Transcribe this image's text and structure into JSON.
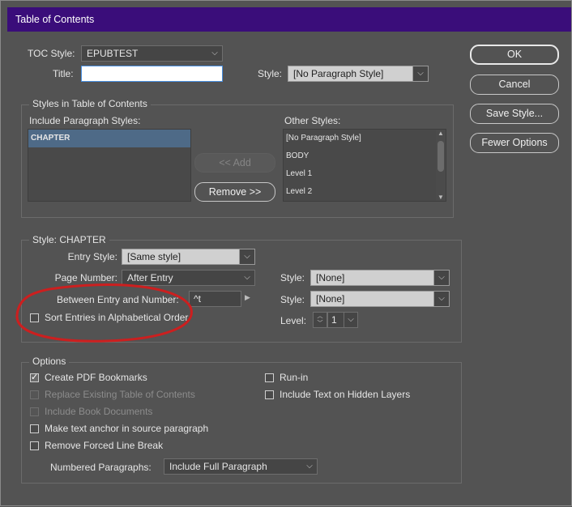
{
  "window": {
    "title": "Table of Contents"
  },
  "top": {
    "toc_style_label": "TOC Style:",
    "toc_style_value": "EPUBTEST",
    "title_label": "Title:",
    "title_value": "",
    "style_label": "Style:",
    "style_value": "[No Paragraph Style]"
  },
  "buttons": {
    "ok": "OK",
    "cancel": "Cancel",
    "save_style": "Save Style...",
    "fewer_options": "Fewer Options",
    "add": "<< Add",
    "remove": "Remove >>"
  },
  "styles_in_toc": {
    "group_title": "Styles in Table of Contents",
    "include_label": "Include Paragraph Styles:",
    "include_items": [
      "CHAPTER"
    ],
    "other_label": "Other Styles:",
    "other_items": [
      "[No Paragraph Style]",
      "BODY",
      "Level 1",
      "Level 2"
    ]
  },
  "style_section": {
    "group_title": "Style: CHAPTER",
    "entry_style_label": "Entry Style:",
    "entry_style_value": "[Same style]",
    "page_number_label": "Page Number:",
    "page_number_value": "After Entry",
    "between_label": "Between Entry and Number:",
    "between_value": "^t",
    "style1_label": "Style:",
    "style1_value": "[None]",
    "style2_label": "Style:",
    "style2_value": "[None]",
    "sort_label": "Sort Entries in Alphabetical Order",
    "level_label": "Level:",
    "level_value": "1"
  },
  "options": {
    "group_title": "Options",
    "create_pdf": "Create PDF Bookmarks",
    "replace_existing": "Replace Existing Table of Contents",
    "include_book": "Include Book Documents",
    "make_anchor": "Make text anchor in source paragraph",
    "remove_forced": "Remove Forced Line Break",
    "run_in": "Run-in",
    "include_hidden": "Include Text on Hidden Layers",
    "numbered_label": "Numbered Paragraphs:",
    "numbered_value": "Include Full Paragraph"
  },
  "colors": {
    "titlebar": "#3a0d7a",
    "dialog_bg": "#535353",
    "annotation": "#cc1f1f"
  }
}
